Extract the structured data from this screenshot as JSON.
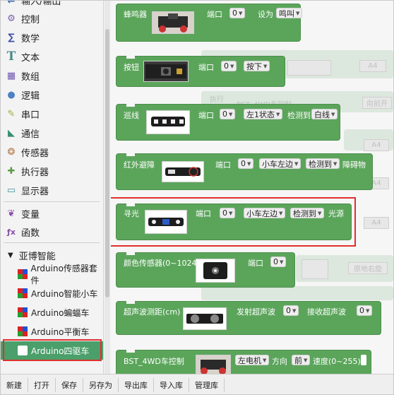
{
  "sidebar": {
    "top_partial": "输入/输出",
    "categories": [
      {
        "label": "控制",
        "color": "#7a5db0"
      },
      {
        "label": "数学",
        "color": "#3c4fa8"
      },
      {
        "label": "文本",
        "color": "#4a8a8a"
      },
      {
        "label": "数组",
        "color": "#6e55b0"
      },
      {
        "label": "逻辑",
        "color": "#4d80c4"
      },
      {
        "label": "串口",
        "color": "#9fae3c"
      },
      {
        "label": "通信",
        "color": "#3a8f6e"
      },
      {
        "label": "传感器",
        "color": "#b07a4e"
      },
      {
        "label": "执行器",
        "color": "#5b9a48"
      },
      {
        "label": "显示器",
        "color": "#3f8fa0"
      },
      {
        "label": "变量",
        "color": "#8a4fa8"
      },
      {
        "label": "函数",
        "color": "#8a4fa8"
      }
    ],
    "group_label": "亚博智能",
    "sub_items": [
      {
        "label": "Arduino传感器套件"
      },
      {
        "label": "Arduino智能小车"
      },
      {
        "label": "Arduino蝙蝠车"
      },
      {
        "label": "Arduino平衡车"
      },
      {
        "label": "Arduino四驱车"
      }
    ]
  },
  "workspace": {
    "blocks": {
      "buzzer": {
        "name": "蜂鸣器",
        "port_label": "端口",
        "port": "0",
        "set_label": "设为",
        "state": "鸣叫"
      },
      "button": {
        "name": "按钮",
        "port_label": "端口",
        "port": "0",
        "state": "按下"
      },
      "line": {
        "name": "巡线",
        "port_label": "端口",
        "port": "0",
        "side": "左1状态",
        "detect_label": "检测到",
        "target": "白线"
      },
      "ir": {
        "name": "红外避障",
        "port_label": "端口",
        "port": "0",
        "side": "小车左边",
        "detect": "检测到",
        "target": "障碍物"
      },
      "light": {
        "name": "寻光",
        "port_label": "端口",
        "port": "0",
        "side": "小车左边",
        "detect": "检测到",
        "target": "光源"
      },
      "color": {
        "name": "颜色传感器(0~1024)",
        "port_label": "端口",
        "port": "0"
      },
      "ultra": {
        "name": "超声波测距(cm)",
        "tx_label": "发射超声波",
        "tx_port": "0",
        "rx_label": "接收超声波",
        "rx_port": "0"
      },
      "motor": {
        "name": "BST_4WD车控制",
        "motor": "左电机",
        "dir_label": "方向",
        "dir": "前",
        "speed_label": "速度(0~255)"
      }
    },
    "ghost": {
      "a4_1": "A4",
      "a4_2": "A4",
      "exec": "执行",
      "bst": "BST_4WD车控制",
      "forward": "向前开",
      "a4_3": "A4",
      "a4_4": "A4",
      "origin": "原地右旋"
    }
  },
  "toolbar": {
    "buttons": [
      "新建",
      "打开",
      "保存",
      "另存为",
      "导出库",
      "导入库",
      "管理库"
    ]
  }
}
